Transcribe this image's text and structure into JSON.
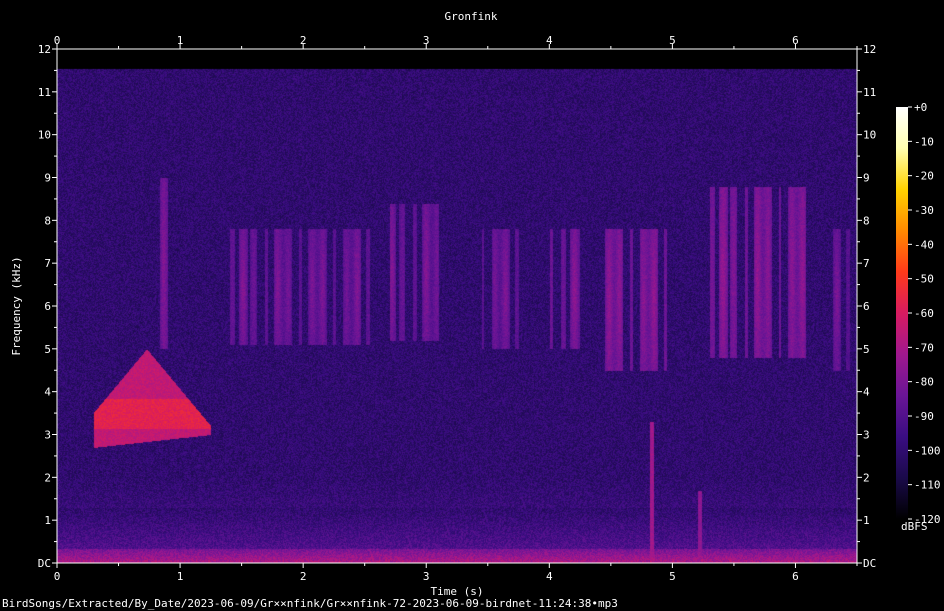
{
  "chart_data": {
    "type": "heatmap",
    "title": "Gronfink",
    "xlabel": "Time (s)",
    "ylabel": "Frequency (kHz)",
    "xlim": [
      0,
      6.5
    ],
    "ylim": [
      0,
      12
    ],
    "x_ticks": [
      {
        "value": 0,
        "label": "0"
      },
      {
        "value": 1,
        "label": "1"
      },
      {
        "value": 2,
        "label": "2"
      },
      {
        "value": 3,
        "label": "3"
      },
      {
        "value": 4,
        "label": "4"
      },
      {
        "value": 5,
        "label": "5"
      },
      {
        "value": 6,
        "label": "6"
      }
    ],
    "y_ticks": [
      {
        "value": 0,
        "label": "DC"
      },
      {
        "value": 1,
        "label": "1"
      },
      {
        "value": 2,
        "label": "2"
      },
      {
        "value": 3,
        "label": "3"
      },
      {
        "value": 4,
        "label": "4"
      },
      {
        "value": 5,
        "label": "5"
      },
      {
        "value": 6,
        "label": "6"
      },
      {
        "value": 7,
        "label": "7"
      },
      {
        "value": 8,
        "label": "8"
      },
      {
        "value": 9,
        "label": "9"
      },
      {
        "value": 10,
        "label": "10"
      },
      {
        "value": 11,
        "label": "11"
      },
      {
        "value": 12,
        "label": "12"
      }
    ],
    "colorbar": {
      "label": "dBFS",
      "range": [
        -120,
        0
      ],
      "ticks": [
        {
          "value": 0,
          "label": "+0"
        },
        {
          "value": -10,
          "label": "-10"
        },
        {
          "value": -20,
          "label": "-20"
        },
        {
          "value": -30,
          "label": "-30"
        },
        {
          "value": -40,
          "label": "-40"
        },
        {
          "value": -50,
          "label": "-50"
        },
        {
          "value": -60,
          "label": "-60"
        },
        {
          "value": -70,
          "label": "-70"
        },
        {
          "value": -80,
          "label": "-80"
        },
        {
          "value": -90,
          "label": "-90"
        },
        {
          "value": -100,
          "label": "-100"
        },
        {
          "value": -110,
          "label": "-110"
        },
        {
          "value": -120,
          "label": "-120"
        }
      ],
      "colors": [
        "#000000",
        "#1a0a4a",
        "#3a0d82",
        "#6a1596",
        "#a0188e",
        "#d81b60",
        "#ff3a1a",
        "#ff8a00",
        "#ffd200",
        "#ffffb0",
        "#ffffff"
      ]
    },
    "max_freq_khz": 11.55,
    "calls": [
      {
        "t_start": 0.3,
        "t_end": 1.25,
        "f_low": 2.6,
        "f_high": 5.0,
        "shape": "tent",
        "level_dbfs": -65
      },
      {
        "t_start": 0.8,
        "t_end": 0.9,
        "f_low": 5.0,
        "f_high": 9.0,
        "shape": "band",
        "level_dbfs": -78
      },
      {
        "t_start": 1.35,
        "t_end": 2.6,
        "f_low": 5.1,
        "f_high": 7.8,
        "shape": "band",
        "level_dbfs": -80
      },
      {
        "t_start": 2.7,
        "t_end": 3.1,
        "f_low": 5.2,
        "f_high": 8.4,
        "shape": "band",
        "level_dbfs": -80
      },
      {
        "t_start": 3.45,
        "t_end": 3.8,
        "f_low": 5.0,
        "f_high": 7.8,
        "shape": "band",
        "level_dbfs": -80
      },
      {
        "t_start": 4.0,
        "t_end": 4.25,
        "f_low": 5.0,
        "f_high": 7.8,
        "shape": "band",
        "level_dbfs": -78
      },
      {
        "t_start": 4.4,
        "t_end": 5.0,
        "f_low": 4.5,
        "f_high": 7.8,
        "shape": "band",
        "level_dbfs": -76
      },
      {
        "t_start": 5.3,
        "t_end": 6.1,
        "f_low": 4.8,
        "f_high": 8.8,
        "shape": "band",
        "level_dbfs": -76
      },
      {
        "t_start": 6.3,
        "t_end": 6.5,
        "f_low": 4.5,
        "f_high": 7.8,
        "shape": "band",
        "level_dbfs": -82
      }
    ],
    "transients": [
      {
        "t": 4.83,
        "f_low": 0.0,
        "f_high": 3.3,
        "level_dbfs": -72
      },
      {
        "t": 5.22,
        "f_low": 0.0,
        "f_high": 1.7,
        "level_dbfs": -76
      }
    ]
  },
  "filepath": "BirdSongs/Extracted/By_Date/2023-06-09/Gr××nfink/Gr××nfink-72-2023-06-09-birdnet-11:24:38•mp3"
}
